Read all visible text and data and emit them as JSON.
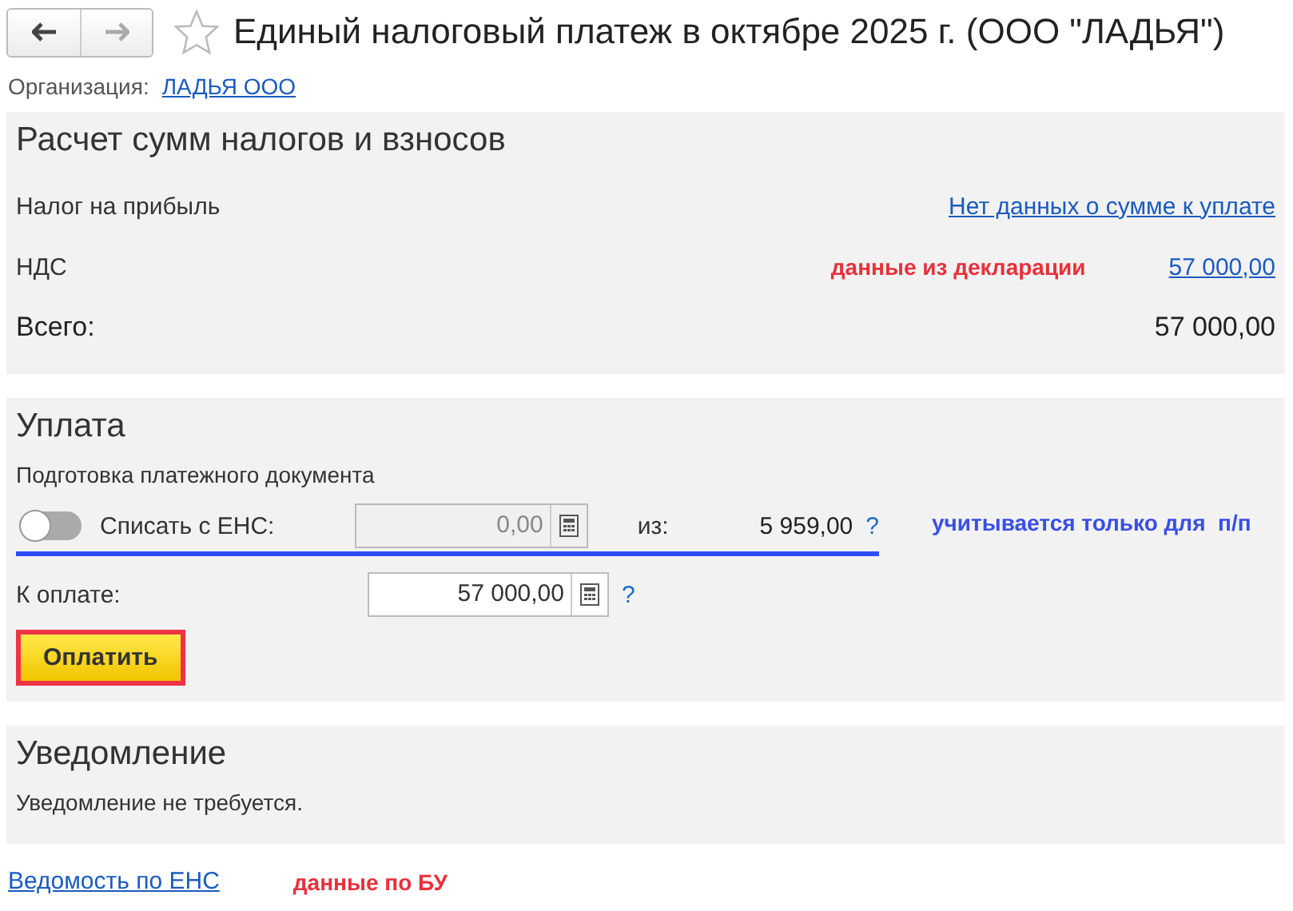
{
  "header": {
    "title": "Единый налоговый платеж в октябре 2025 г. (ООО \"ЛАДЬЯ\")",
    "back_disabled": false,
    "forward_disabled": true,
    "favorite": false
  },
  "organization": {
    "label": "Организация:",
    "value": "ЛАДЬЯ ООО"
  },
  "taxes": {
    "title": "Расчет сумм налогов и взносов",
    "rows": [
      {
        "name": "Налог на прибыль",
        "value": "Нет данных о сумме к уплате"
      },
      {
        "name": "НДС",
        "note": "данные из декларации",
        "value": "57 000,00"
      }
    ],
    "total": {
      "label": "Всего:",
      "value": "57 000,00"
    }
  },
  "payment": {
    "title": "Уплата",
    "subtitle": "Подготовка платежного документа",
    "offset": {
      "on": false,
      "label": "Списать с ЕНС:",
      "value": "0,00",
      "disabled": true,
      "of_label": "из:",
      "balance": "5 959,00",
      "help": "?",
      "note": "учитывается только для  п/п"
    },
    "to_pay": {
      "label": "К оплате:",
      "value": "57 000,00",
      "help": "?"
    },
    "button": "Оплатить"
  },
  "notification": {
    "title": "Уведомление",
    "text": "Уведомление не требуется."
  },
  "footer": {
    "link": "Ведомость по ЕНС",
    "note": "данные по БУ"
  }
}
